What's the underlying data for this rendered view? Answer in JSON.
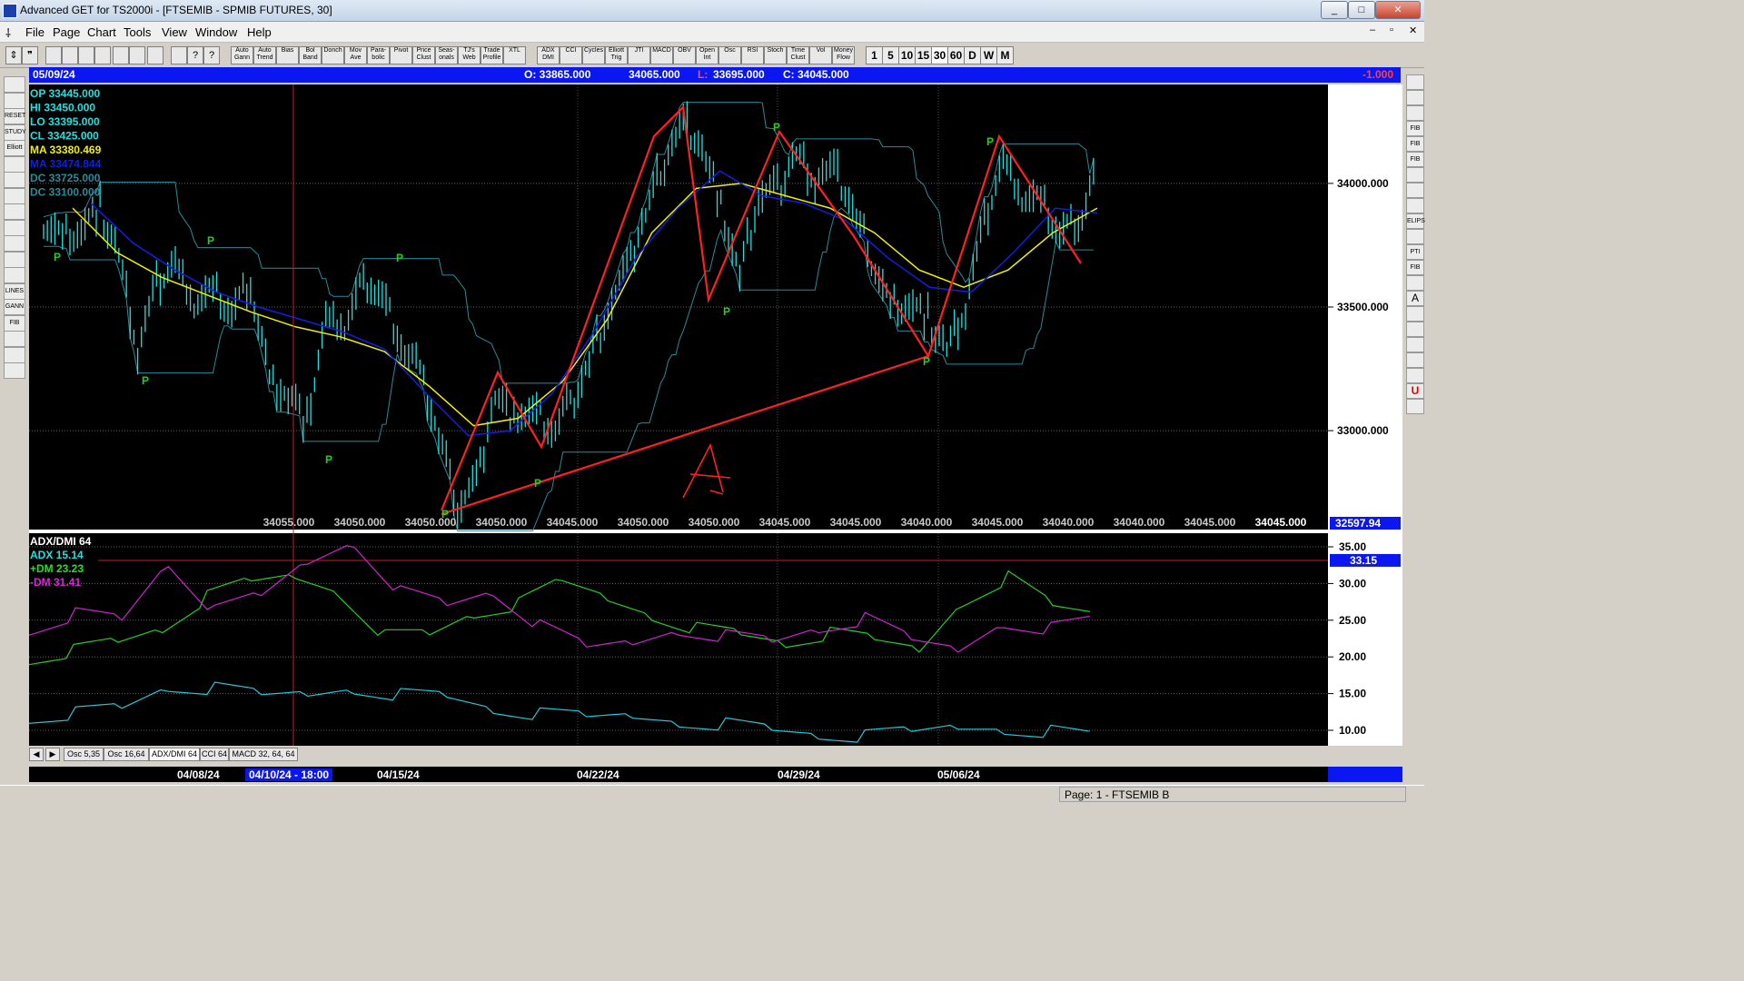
{
  "window": {
    "title": "Advanced GET for TS2000i - [FTSEMIB - SPMIB FUTURES, 30]",
    "controls": [
      "_",
      "□",
      "✕"
    ]
  },
  "menu": [
    "File",
    "Page",
    "Chart",
    "Tools",
    "View",
    "Window",
    "Help"
  ],
  "toolbar": {
    "study_buttons": [
      "Auto Gann",
      "Auto Trend",
      "Bias",
      "Bol Band",
      "Donch",
      "Mov Ave",
      "Para-bolic",
      "Pivot",
      "Price Clust",
      "Seas-onals",
      "TJ's Web",
      "Trade Profile",
      "XTL",
      "ADX DMI",
      "CCI",
      "Cycles",
      "Elliott Trig",
      "JTI",
      "MACD",
      "OBV",
      "Open Int",
      "Osc",
      "RSI",
      "Stoch",
      "Time Clust",
      "Vol",
      "Money Flow"
    ],
    "periods": [
      "1",
      "5",
      "10",
      "15",
      "30",
      "60",
      "D",
      "W",
      "M"
    ]
  },
  "left_tools": [
    "RESET",
    "STUDY",
    "Elliott",
    "LINES",
    "GANN",
    "FIB"
  ],
  "right_tools": [
    "FIB RET",
    "FIB EXT",
    "FIB TIME",
    "ELIPS",
    "PTI",
    "FIB",
    "A",
    "U"
  ],
  "info_bar": {
    "date": "05/09/24",
    "open": "O: 33865.000",
    "high": "34065.000",
    "low_label": "L:",
    "low": "33695.000",
    "close": "C: 34045.000",
    "change": "-1.000"
  },
  "price_panel": {
    "legend": [
      {
        "label": "OP",
        "value": "33445.000",
        "color": "#22e0e0"
      },
      {
        "label": "HI",
        "value": "33450.000",
        "color": "#22e0e0"
      },
      {
        "label": "LO",
        "value": "33395.000",
        "color": "#22e0e0"
      },
      {
        "label": "CL",
        "value": "33425.000",
        "color": "#22e0e0"
      },
      {
        "label": "MA",
        "value": "33380.469",
        "color": "#f0f000"
      },
      {
        "label": "MA",
        "value": "33474.844",
        "color": "#1020e0"
      },
      {
        "label": "DC",
        "value": "33725.000",
        "color": "#2a8a9a"
      },
      {
        "label": "DC",
        "value": "33100.000",
        "color": "#2a8a9a"
      }
    ],
    "axis_labels": [
      "34000.000",
      "33500.000",
      "33000.000"
    ],
    "current_price": "32597.94",
    "bottom_values": [
      "34055.000",
      "34050.000",
      "34050.000",
      "34050.000",
      "34045.000",
      "34050.000",
      "34050.000",
      "34045.000",
      "34045.000",
      "34040.000",
      "34045.000",
      "34040.000",
      "34040.000",
      "34045.000",
      "34045.000"
    ],
    "pivot_marker": "P"
  },
  "adx_panel": {
    "title": "ADX/DMI 64",
    "legend": [
      {
        "label": "ADX",
        "value": "15.14",
        "color": "#22e0e0"
      },
      {
        "label": "+DM",
        "value": "23.23",
        "color": "#22e022"
      },
      {
        "label": "-DM",
        "value": "31.41",
        "color": "#e022e0"
      }
    ],
    "axis_labels": [
      "35.00",
      "30.00",
      "25.00",
      "20.00",
      "15.00",
      "10.00"
    ],
    "level_value": "33.15"
  },
  "tabs": [
    "Osc 5,35",
    "Osc 16,64",
    "ADX/DMI 64",
    "CCI 64",
    "MACD 32, 64, 64"
  ],
  "date_bar": {
    "dates": [
      "04/08/24",
      "04/15/24",
      "04/22/24",
      "04/29/24",
      "05/06/24"
    ],
    "cursor_date": "04/10/24 - 18:00"
  },
  "status": "Page: 1 - FTSEMIB B",
  "chart_data": {
    "type": "line",
    "x_dates": [
      "04/08/24",
      "04/15/24",
      "04/22/24",
      "04/29/24",
      "05/06/24"
    ],
    "ylim": [
      32600,
      34400
    ],
    "price_close": [
      33850,
      33780,
      33820,
      33900,
      33700,
      33320,
      33600,
      33680,
      33520,
      33560,
      33480,
      33600,
      33200,
      33150,
      33040,
      33450,
      33420,
      33600,
      33550,
      33360,
      33230,
      32980,
      32700,
      32800,
      33150,
      33050,
      33080,
      33000,
      33100,
      33280,
      33500,
      33650,
      33880,
      34100,
      34250,
      34150,
      33900,
      33620,
      33950,
      33980,
      34120,
      34020,
      34060,
      33900,
      33700,
      33500,
      33520,
      33450,
      33320,
      33500,
      33850,
      34100,
      33950,
      33920,
      33800,
      33850,
      34050
    ],
    "ma_slow": [
      33900,
      33720,
      33620,
      33550,
      33480,
      33420,
      33380,
      33320,
      33180,
      33020,
      33050,
      33200,
      33450,
      33800,
      33980,
      34000,
      33950,
      33900,
      33800,
      33650,
      33580,
      33650,
      33800,
      33900
    ],
    "ma_fast": [
      33920,
      33760,
      33650,
      33560,
      33500,
      33450,
      33400,
      33330,
      33150,
      32980,
      33000,
      33150,
      33400,
      33700,
      33900,
      34050,
      33950,
      33920,
      33850,
      33700,
      33580,
      33560,
      33720,
      33900,
      33880
    ],
    "adx": [
      12,
      12.5,
      13,
      16,
      15.5,
      14.5,
      15,
      16,
      15,
      14.5,
      13,
      12,
      11.5,
      12,
      11.5,
      11,
      10,
      9.5,
      9,
      9.5,
      10.5,
      10.5,
      10,
      9
    ],
    "plus_dm": [
      20,
      21,
      22,
      24,
      28,
      30,
      31,
      29,
      23,
      23,
      26,
      27,
      30,
      28,
      26,
      24,
      23,
      22,
      23,
      22,
      21,
      28,
      31,
      27,
      26
    ],
    "minus_dm": [
      24,
      26,
      25,
      33,
      26,
      28,
      33,
      36,
      29,
      27,
      29,
      24,
      21,
      22,
      24,
      23,
      22,
      24,
      25,
      22,
      21,
      25,
      24,
      25
    ],
    "level": 33.15
  }
}
